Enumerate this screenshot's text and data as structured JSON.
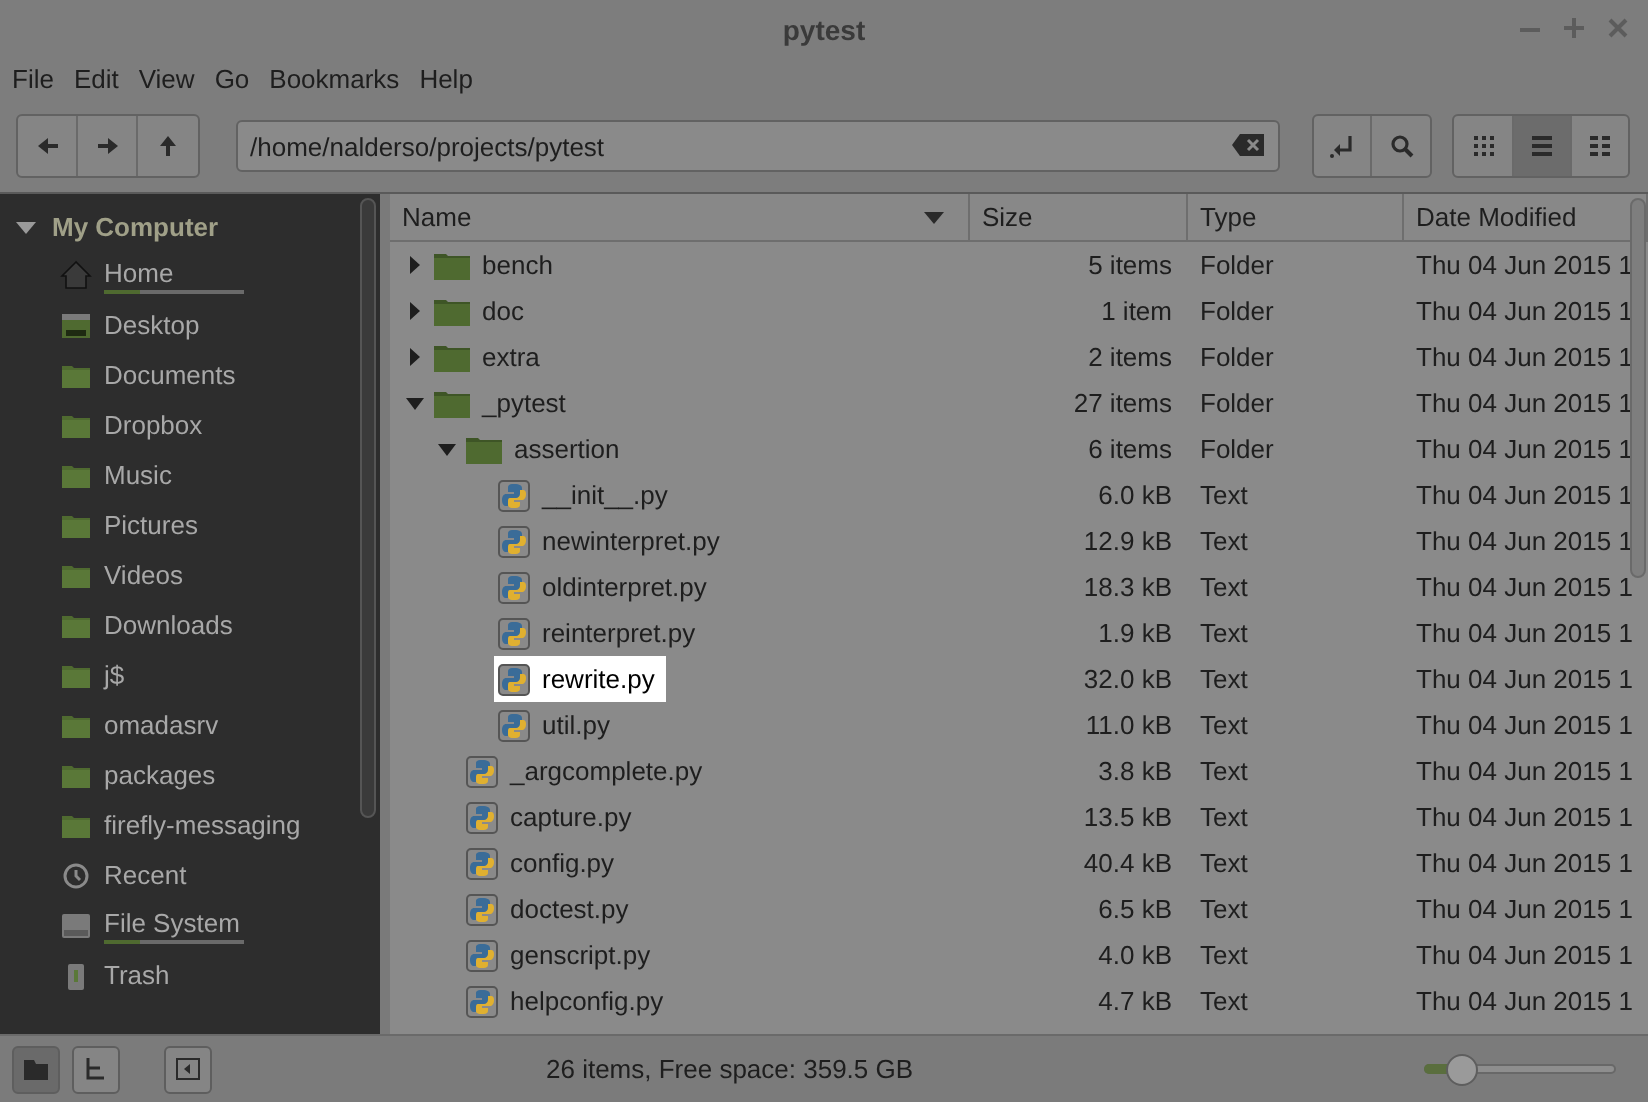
{
  "window": {
    "title": "pytest"
  },
  "menu": [
    "File",
    "Edit",
    "View",
    "Go",
    "Bookmarks",
    "Help"
  ],
  "location": {
    "value": "/home/nalderso/projects/pytest"
  },
  "views": [
    {
      "kind": "icons",
      "selected": false
    },
    {
      "kind": "list",
      "selected": true
    },
    {
      "kind": "compact",
      "selected": false
    }
  ],
  "sidebar": {
    "heading": "My Computer",
    "expanded": true,
    "items": [
      {
        "label": "Home",
        "kind": "home",
        "level": 0.25
      },
      {
        "label": "Desktop",
        "kind": "desktop"
      },
      {
        "label": "Documents",
        "kind": "folder"
      },
      {
        "label": "Dropbox",
        "kind": "folder"
      },
      {
        "label": "Music",
        "kind": "folder"
      },
      {
        "label": "Pictures",
        "kind": "folder"
      },
      {
        "label": "Videos",
        "kind": "folder"
      },
      {
        "label": "Downloads",
        "kind": "folder"
      },
      {
        "label": "j$",
        "kind": "folder"
      },
      {
        "label": "omadasrv",
        "kind": "folder"
      },
      {
        "label": "packages",
        "kind": "folder"
      },
      {
        "label": "firefly-messaging",
        "kind": "folder"
      },
      {
        "label": "Recent",
        "kind": "recent"
      },
      {
        "label": "File System",
        "kind": "drive",
        "level": 0.25
      },
      {
        "label": "Trash",
        "kind": "trash"
      }
    ]
  },
  "table": {
    "columns": [
      "Name",
      "Size",
      "Type",
      "Date Modified"
    ],
    "rows": [
      {
        "kind": "folder",
        "name": "bench",
        "size": "5 items",
        "type": "Folder",
        "date": "Thu 04 Jun 2015 1",
        "expanded": false
      },
      {
        "kind": "folder",
        "name": "doc",
        "size": "1 item",
        "type": "Folder",
        "date": "Thu 04 Jun 2015 1",
        "expanded": false
      },
      {
        "kind": "folder",
        "name": "extra",
        "size": "2 items",
        "type": "Folder",
        "date": "Thu 04 Jun 2015 1",
        "expanded": false
      },
      {
        "kind": "folder",
        "name": "_pytest",
        "size": "27 items",
        "type": "Folder",
        "date": "Thu 04 Jun 2015 1",
        "expanded": true,
        "children": [
          {
            "kind": "folder",
            "name": "assertion",
            "size": "6 items",
            "type": "Folder",
            "date": "Thu 04 Jun 2015 1",
            "expanded": true,
            "children": [
              {
                "kind": "file",
                "name": "__init__.py",
                "size": "6.0 kB",
                "type": "Text",
                "date": "Thu 04 Jun 2015 1",
                "highlighted": false
              },
              {
                "kind": "file",
                "name": "newinterpret.py",
                "size": "12.9 kB",
                "type": "Text",
                "date": "Thu 04 Jun 2015 1",
                "highlighted": false
              },
              {
                "kind": "file",
                "name": "oldinterpret.py",
                "size": "18.3 kB",
                "type": "Text",
                "date": "Thu 04 Jun 2015 1",
                "highlighted": false
              },
              {
                "kind": "file",
                "name": "reinterpret.py",
                "size": "1.9 kB",
                "type": "Text",
                "date": "Thu 04 Jun 2015 1",
                "highlighted": false
              },
              {
                "kind": "file",
                "name": "rewrite.py",
                "size": "32.0 kB",
                "type": "Text",
                "date": "Thu 04 Jun 2015 1",
                "highlighted": true
              },
              {
                "kind": "file",
                "name": "util.py",
                "size": "11.0 kB",
                "type": "Text",
                "date": "Thu 04 Jun 2015 1",
                "highlighted": false
              }
            ]
          },
          {
            "kind": "file",
            "name": "_argcomplete.py",
            "size": "3.8 kB",
            "type": "Text",
            "date": "Thu 04 Jun 2015 1",
            "highlighted": false
          },
          {
            "kind": "file",
            "name": "capture.py",
            "size": "13.5 kB",
            "type": "Text",
            "date": "Thu 04 Jun 2015 1",
            "highlighted": false
          },
          {
            "kind": "file",
            "name": "config.py",
            "size": "40.4 kB",
            "type": "Text",
            "date": "Thu 04 Jun 2015 1",
            "highlighted": false
          },
          {
            "kind": "file",
            "name": "doctest.py",
            "size": "6.5 kB",
            "type": "Text",
            "date": "Thu 04 Jun 2015 1",
            "highlighted": false
          },
          {
            "kind": "file",
            "name": "genscript.py",
            "size": "4.0 kB",
            "type": "Text",
            "date": "Thu 04 Jun 2015 1",
            "highlighted": false
          },
          {
            "kind": "file",
            "name": "helpconfig.py",
            "size": "4.7 kB",
            "type": "Text",
            "date": "Thu 04 Jun 2015 1",
            "highlighted": false
          }
        ]
      }
    ]
  },
  "status_bar": {
    "text": "26 items, Free space: 359.5 GB",
    "panes": [
      {
        "kind": "places",
        "selected": true
      },
      {
        "kind": "tree",
        "selected": false
      },
      {
        "kind": "hide",
        "selected": false
      }
    ],
    "zoom": {
      "level": 0.2
    }
  }
}
